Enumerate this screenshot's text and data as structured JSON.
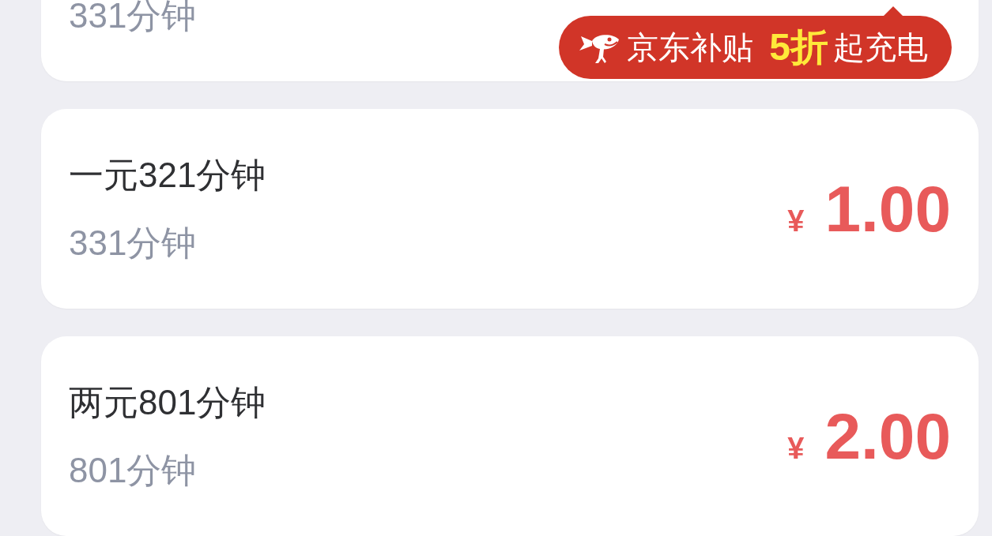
{
  "cards": [
    {
      "subtitle": "331分钟",
      "badge": {
        "prefix": "京东补贴",
        "highlight": "5折",
        "suffix": "起充电"
      }
    },
    {
      "title": "一元321分钟",
      "subtitle": "331分钟",
      "currency": "¥",
      "amount": "1.00"
    },
    {
      "title": "两元801分钟",
      "subtitle": "801分钟",
      "currency": "¥",
      "amount": "2.00"
    }
  ]
}
